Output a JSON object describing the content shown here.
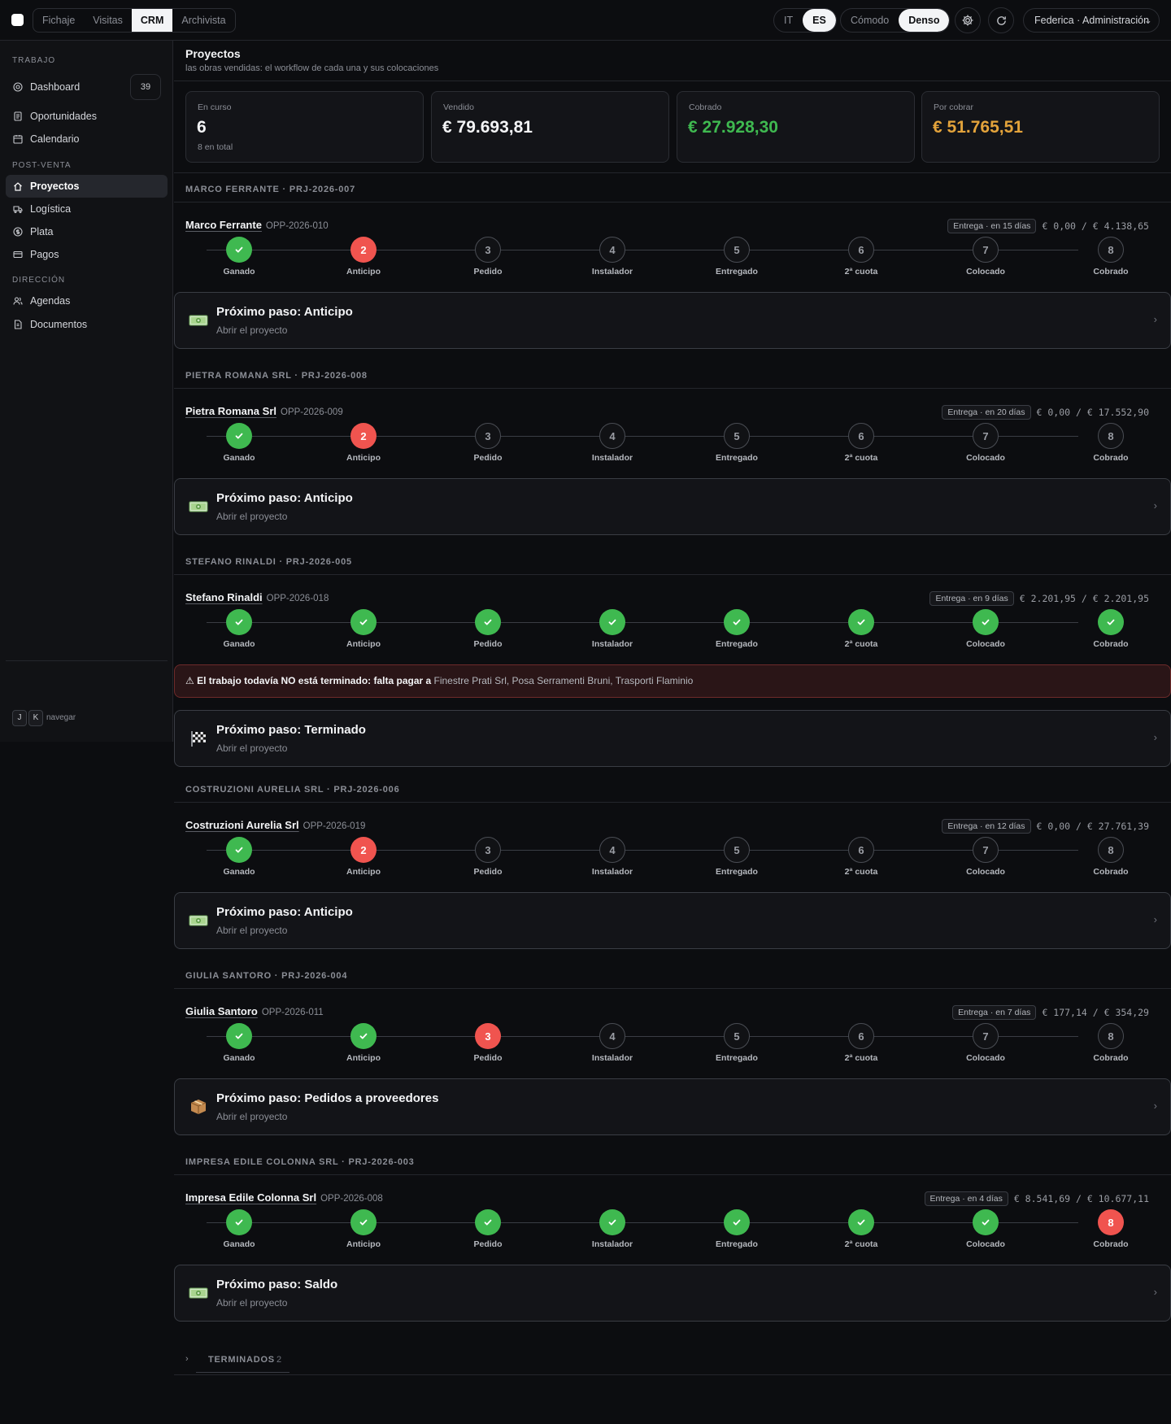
{
  "topbar": {
    "nav_tabs": [
      "Fichaje",
      "Visitas",
      "CRM",
      "Archivista"
    ],
    "active_tab": "CRM",
    "languages": [
      "IT",
      "ES"
    ],
    "active_language": "ES",
    "density": [
      "Cómodo",
      "Denso"
    ],
    "active_density": "Denso",
    "settings_icon": "gear-icon",
    "refresh_icon": "refresh-icon",
    "user": "Federica · Administración"
  },
  "sidebar": {
    "sections": [
      {
        "title": "TRABAJO",
        "items": [
          {
            "label": "Dashboard",
            "icon": "target-icon",
            "badge": "39"
          },
          {
            "label": "Oportunidades",
            "icon": "document-icon"
          },
          {
            "label": "Calendario",
            "icon": "calendar-icon"
          }
        ]
      },
      {
        "title": "POST-VENTA",
        "items": [
          {
            "label": "Proyectos",
            "icon": "home-icon",
            "active": true
          },
          {
            "label": "Logística",
            "icon": "truck-icon"
          },
          {
            "label": "Plata",
            "icon": "coin-icon"
          },
          {
            "label": "Pagos",
            "icon": "card-icon"
          }
        ]
      },
      {
        "title": "DIRECCIÓN",
        "items": [
          {
            "label": "Agendas",
            "icon": "users-icon"
          },
          {
            "label": "Documentos",
            "icon": "file-icon"
          }
        ]
      }
    ],
    "shortcut_keys": [
      "J",
      "K"
    ],
    "shortcut_label": "navegar"
  },
  "page": {
    "title": "Proyectos",
    "subtitle": "las obras vendidas: el workflow de cada una y sus colocaciones"
  },
  "stats": [
    {
      "label": "En curso",
      "value": "6",
      "sub": "8 en total",
      "color": "#f3f4f6"
    },
    {
      "label": "Vendido",
      "value": "€ 79.693,81",
      "sub": "",
      "color": "#f3f4f6"
    },
    {
      "label": "Cobrado",
      "value": "€ 27.928,30",
      "sub": "",
      "color": "#3fb950"
    },
    {
      "label": "Por cobrar",
      "value": "€ 51.765,51",
      "sub": "",
      "color": "#e3a33b"
    }
  ],
  "step_labels": [
    "Ganado",
    "Anticipo",
    "Pedido",
    "Instalador",
    "Entregado",
    "2ª cuota",
    "Colocado",
    "Cobrado"
  ],
  "projects": [
    {
      "header": "MARCO FERRANTE · PRJ-2026-007",
      "client": "Marco Ferrante",
      "opp": "OPP-2026-010",
      "delivery": "Entrega · en 15 días",
      "amounts": "€ 0,00 / € 4.138,65",
      "current_step": 2,
      "alert": null,
      "next": {
        "icon": "money-icon",
        "title": "Próximo paso: Anticipo",
        "sub": "Abrir el proyecto"
      }
    },
    {
      "header": "PIETRA ROMANA SRL · PRJ-2026-008",
      "client": "Pietra Romana Srl",
      "opp": "OPP-2026-009",
      "delivery": "Entrega · en 20 días",
      "amounts": "€ 0,00 / € 17.552,90",
      "current_step": 2,
      "alert": null,
      "next": {
        "icon": "money-icon",
        "title": "Próximo paso: Anticipo",
        "sub": "Abrir el proyecto"
      }
    },
    {
      "header": "STEFANO RINALDI · PRJ-2026-005",
      "client": "Stefano Rinaldi",
      "opp": "OPP-2026-018",
      "delivery": "Entrega · en 9 días",
      "amounts": "€ 2.201,95 / € 2.201,95",
      "current_step": 9,
      "alert": {
        "strong": "⚠ El trabajo todavía NO está terminado: falta pagar a",
        "names": "Finestre Prati Srl, Posa Serramenti Bruni, Trasporti Flaminio"
      },
      "next": {
        "icon": "checkered-flag-icon",
        "title": "Próximo paso: Terminado",
        "sub": "Abrir el proyecto"
      }
    },
    {
      "header": "COSTRUZIONI AURELIA SRL · PRJ-2026-006",
      "client": "Costruzioni Aurelia Srl",
      "opp": "OPP-2026-019",
      "delivery": "Entrega · en 12 días",
      "amounts": "€ 0,00 / € 27.761,39",
      "current_step": 2,
      "alert": null,
      "next": {
        "icon": "money-icon",
        "title": "Próximo paso: Anticipo",
        "sub": "Abrir el proyecto"
      }
    },
    {
      "header": "GIULIA SANTORO · PRJ-2026-004",
      "client": "Giulia Santoro",
      "opp": "OPP-2026-011",
      "delivery": "Entrega · en 7 días",
      "amounts": "€ 177,14 / € 354,29",
      "current_step": 3,
      "alert": null,
      "next": {
        "icon": "package-icon",
        "title": "Próximo paso: Pedidos a proveedores",
        "sub": "Abrir el proyecto"
      }
    },
    {
      "header": "IMPRESA EDILE COLONNA SRL · PRJ-2026-003",
      "client": "Impresa Edile Colonna Srl",
      "opp": "OPP-2026-008",
      "delivery": "Entrega · en 4 días",
      "amounts": "€ 8.541,69 / € 10.677,11",
      "current_step": 8,
      "alert": null,
      "next": {
        "icon": "money-icon",
        "title": "Próximo paso: Saldo",
        "sub": "Abrir el proyecto"
      }
    }
  ],
  "terminated": {
    "label": "TERMINADOS",
    "count": "2"
  },
  "colors": {
    "done": "#3fb950",
    "current": "#f0544f",
    "collected": "#3fb950",
    "pending": "#e3a33b"
  }
}
